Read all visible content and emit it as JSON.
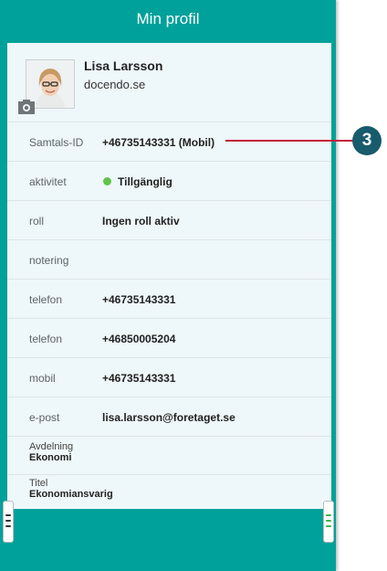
{
  "header": {
    "title": "Min profil"
  },
  "profile": {
    "name": "Lisa Larsson",
    "organization": "docendo.se"
  },
  "fields": [
    {
      "label": "Samtals-ID",
      "value": "+46735143331 (Mobil)"
    },
    {
      "label": "aktivitet",
      "value": "Tillgänglig",
      "status_color": "#5fc44a"
    },
    {
      "label": "roll",
      "value": "Ingen roll aktiv"
    },
    {
      "label": "notering",
      "value": ""
    },
    {
      "label": "telefon",
      "value": "+46735143331"
    },
    {
      "label": "telefon",
      "value": "+46850005204"
    },
    {
      "label": "mobil",
      "value": "+46735143331"
    },
    {
      "label": "e-post",
      "value": "lisa.larsson@foretaget.se"
    }
  ],
  "details": [
    {
      "label": "Avdelning",
      "value": "Ekonomi"
    },
    {
      "label": "Titel",
      "value": "Ekonomiansvarig"
    }
  ],
  "callout": {
    "number": "3",
    "color": "#c41e3a",
    "badge_color": "#175b6c"
  },
  "colors": {
    "brand": "#00a19a",
    "panel": "#eef7f9",
    "status_available": "#5fc44a"
  },
  "icons": {
    "camera": "camera-icon",
    "left_handle": "menu-handle-left-icon",
    "right_handle": "menu-handle-right-icon"
  }
}
